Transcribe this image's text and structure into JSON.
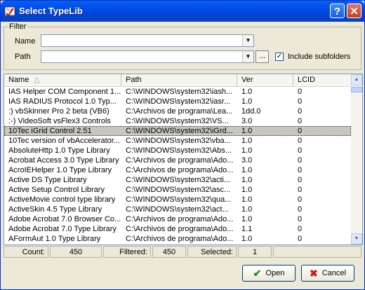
{
  "window": {
    "title": "Select TypeLib",
    "help_glyph": "?",
    "close_glyph": "✕"
  },
  "filter": {
    "legend": "Filter",
    "name_label": "Name",
    "path_label": "Path",
    "name_value": "",
    "path_value": "",
    "browse_label": "...",
    "include_subfolders_label": "Include subfolders",
    "include_subfolders_checked": true
  },
  "list": {
    "columns": [
      "Name",
      "Path",
      "Ver",
      "LCID"
    ],
    "sort_indicator": "△",
    "selected_index": 4,
    "rows": [
      [
        "IAS Helper COM Component 1....",
        "C:\\WINDOWS\\system32\\iash...",
        "1.0",
        "0"
      ],
      [
        "IAS RADIUS Protocol 1.0 Typ...",
        "C:\\WINDOWS\\system32\\iasr...",
        "1.0",
        "0"
      ],
      [
        ":) vbSkinner Pro 2 beta (VB6)",
        "C:\\Archivos de programa\\Lea...",
        "1dd.0",
        "0"
      ],
      [
        ":-) VideoSoft vsFlex3 Controls",
        "C:\\WINDOWS\\system32\\VS...",
        "3.0",
        "0"
      ],
      [
        "10Tec iGrid Control 2.51",
        "C:\\WINDOWS\\system32\\iGrd...",
        "1.0",
        "0"
      ],
      [
        "10Tec version of vbAccelerator...",
        "C:\\WINDOWS\\system32\\vba...",
        "1.0",
        "0"
      ],
      [
        "AbsoluteHttp 1.0 Type Library",
        "C:\\WINDOWS\\system32\\Abs...",
        "1.0",
        "0"
      ],
      [
        "Acrobat Access 3.0 Type Library",
        "C:\\Archivos de programa\\Ado...",
        "3.0",
        "0"
      ],
      [
        "AcroIEHelper 1.0 Type Library",
        "C:\\Archivos de programa\\Ado...",
        "1.0",
        "0"
      ],
      [
        "Active DS Type Library",
        "C:\\WINDOWS\\system32\\acti...",
        "1.0",
        "0"
      ],
      [
        "Active Setup Control Library",
        "C:\\WINDOWS\\system32\\asc...",
        "1.0",
        "0"
      ],
      [
        "ActiveMovie control type library",
        "C:\\WINDOWS\\system32\\qua...",
        "1.0",
        "0"
      ],
      [
        "ActiveSkin 4.5 Type Library",
        "C:\\WINDOWS\\system32\\act...",
        "1.0",
        "0"
      ],
      [
        "Adobe Acrobat 7.0 Browser Co...",
        "C:\\Archivos de programa\\Ado...",
        "1.0",
        "0"
      ],
      [
        "Adobe Acrobat 7.0 Type Library",
        "C:\\Archivos de programa\\Ado...",
        "1.1",
        "0"
      ],
      [
        "AFormAut 1.0 Type Library",
        "C:\\Archivos de programa\\Ado...",
        "1.0",
        "0"
      ]
    ]
  },
  "status": {
    "count_label": "Count:",
    "count_value": "450",
    "filtered_label": "Filtered:",
    "filtered_value": "450",
    "selected_label": "Selected:",
    "selected_value": "1"
  },
  "buttons": {
    "open_label": "Open",
    "open_icon": "check-icon",
    "cancel_label": "Cancel",
    "cancel_icon": "cross-icon"
  },
  "colors": {
    "titlebar": "#0054e3",
    "selected_row": "#c9c6bd",
    "open_check": "#1a8a1a",
    "cancel_cross": "#d0181b"
  }
}
